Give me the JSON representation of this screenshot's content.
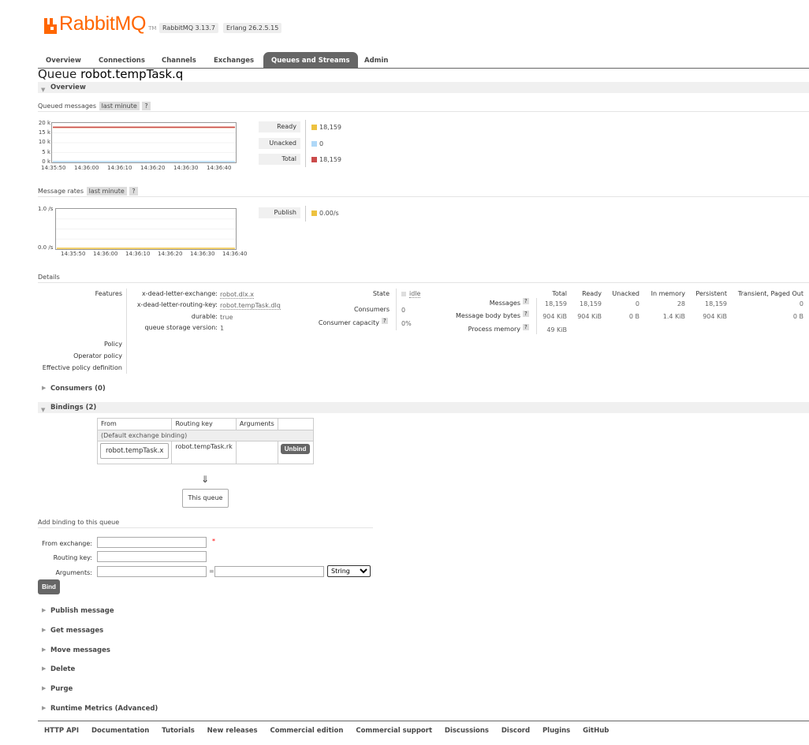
{
  "header": {
    "logo_text": "RabbitMQ",
    "logo_tm": "TM",
    "version": "RabbitMQ 3.13.7",
    "erlang": "Erlang 26.2.5.15",
    "colors": {
      "brand": "#ff6600",
      "tab_active": "#666666"
    }
  },
  "tabs": [
    {
      "label": "Overview",
      "active": false
    },
    {
      "label": "Connections",
      "active": false
    },
    {
      "label": "Channels",
      "active": false
    },
    {
      "label": "Exchanges",
      "active": false
    },
    {
      "label": "Queues and Streams",
      "active": true
    },
    {
      "label": "Admin",
      "active": false
    }
  ],
  "title": {
    "prefix": "Queue",
    "queue_name": "robot.tempTask.q"
  },
  "overview": {
    "header": "Overview",
    "queued": {
      "label": "Queued messages",
      "range": "last minute",
      "help": "?",
      "y_ticks": [
        "20 k",
        "15 k",
        "10 k",
        "5 k",
        "0 k"
      ],
      "x_ticks": [
        "14:35:50",
        "14:36:00",
        "14:36:10",
        "14:36:20",
        "14:36:30",
        "14:36:40"
      ],
      "legend": [
        {
          "label": "Ready",
          "value": "18,159",
          "color": "#edc240"
        },
        {
          "label": "Unacked",
          "value": "0",
          "color": "#afd8f8"
        },
        {
          "label": "Total",
          "value": "18,159",
          "color": "#cb4b4b"
        }
      ]
    },
    "rates": {
      "label": "Message rates",
      "range": "last minute",
      "help": "?",
      "y_ticks": [
        "1.0 /s",
        "0.0 /s"
      ],
      "x_ticks": [
        "14:35:50",
        "14:36:00",
        "14:36:10",
        "14:36:20",
        "14:36:30",
        "14:36:40"
      ],
      "legend": [
        {
          "label": "Publish",
          "value": "0.00/s",
          "color": "#edc240"
        }
      ]
    }
  },
  "chart_data": [
    {
      "type": "line",
      "x": [
        "14:35:50",
        "14:36:00",
        "14:36:10",
        "14:36:20",
        "14:36:30",
        "14:36:40"
      ],
      "ylim": [
        0,
        20000
      ],
      "series": [
        {
          "name": "Ready",
          "values": [
            18159,
            18159,
            18159,
            18159,
            18159,
            18159
          ]
        },
        {
          "name": "Unacked",
          "values": [
            0,
            0,
            0,
            0,
            0,
            0
          ]
        },
        {
          "name": "Total",
          "values": [
            18159,
            18159,
            18159,
            18159,
            18159,
            18159
          ]
        }
      ]
    },
    {
      "type": "line",
      "x": [
        "14:35:50",
        "14:36:00",
        "14:36:10",
        "14:36:20",
        "14:36:30",
        "14:36:40"
      ],
      "ylim": [
        0,
        1
      ],
      "series": [
        {
          "name": "Publish",
          "values": [
            0,
            0,
            0,
            0,
            0,
            0
          ]
        }
      ]
    }
  ],
  "details": {
    "header": "Details",
    "features_label": "Features",
    "features": [
      {
        "key": "x-dead-letter-exchange:",
        "value": "robot.dlx.x"
      },
      {
        "key": "x-dead-letter-routing-key:",
        "value": "robot.tempTask.dlq"
      },
      {
        "key": "durable:",
        "value": "true"
      },
      {
        "key": "queue storage version:",
        "value": "1"
      }
    ],
    "policy_label": "Policy",
    "operator_policy_label": "Operator policy",
    "effective_policy_label": "Effective policy definition",
    "state_label": "State",
    "state_value": "idle",
    "consumers_label": "Consumers",
    "consumers_value": "0",
    "capacity_label": "Consumer capacity",
    "capacity_help": "?",
    "capacity_value": "0%",
    "stats": {
      "columns": [
        "Total",
        "Ready",
        "Unacked",
        "In memory",
        "Persistent",
        "Transient, Paged Out"
      ],
      "rows": [
        {
          "label": "Messages",
          "help": "?",
          "values": [
            "18,159",
            "18,159",
            "0",
            "28",
            "18,159",
            "0"
          ]
        },
        {
          "label": "Message body bytes",
          "help": "?",
          "values": [
            "904 KiB",
            "904 KiB",
            "0 B",
            "1.4 KiB",
            "904 KiB",
            "0 B"
          ]
        },
        {
          "label": "Process memory",
          "help": "?",
          "values": [
            "49 KiB"
          ]
        }
      ]
    }
  },
  "consumers": {
    "header": "Consumers (0)"
  },
  "bindings": {
    "header": "Bindings (2)",
    "columns": [
      "From",
      "Routing key",
      "Arguments"
    ],
    "default_row": "(Default exchange binding)",
    "rows": [
      {
        "from": "robot.tempTask.x",
        "routing_key": "robot.tempTask.rk",
        "arguments": "",
        "action": "Unbind"
      }
    ],
    "arrow": "⇓",
    "this_queue": "This queue"
  },
  "add_binding": {
    "header": "Add binding to this queue",
    "from_label": "From exchange:",
    "from_value": "",
    "required_mark": "*",
    "routing_label": "Routing key:",
    "routing_value": "",
    "args_label": "Arguments:",
    "args_key": "",
    "args_eq": "=",
    "args_value": "",
    "type_selected": "String",
    "button": "Bind"
  },
  "collapsed_sections": [
    "Publish message",
    "Get messages",
    "Move messages",
    "Delete",
    "Purge",
    "Runtime Metrics (Advanced)"
  ],
  "footer": [
    "HTTP API",
    "Documentation",
    "Tutorials",
    "New releases",
    "Commercial edition",
    "Commercial support",
    "Discussions",
    "Discord",
    "Plugins",
    "GitHub"
  ]
}
